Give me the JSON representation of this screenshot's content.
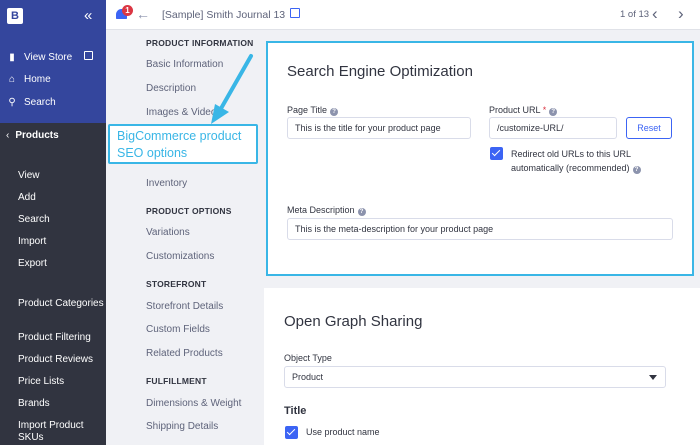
{
  "sidebar": {
    "logo": "B",
    "links": [
      {
        "label": "View Store",
        "icon": "store-icon"
      },
      {
        "label": "Home",
        "icon": "home-icon"
      },
      {
        "label": "Search",
        "icon": "search-icon"
      }
    ],
    "section": "Products",
    "items_group1": [
      "View",
      "Add",
      "Search",
      "Import",
      "Export"
    ],
    "items_group2": [
      "Product Categories",
      "Product Filtering",
      "Product Reviews",
      "Price Lists",
      "Brands",
      "Import Product SKUs"
    ]
  },
  "topbar": {
    "notification_count": "1",
    "title": "[Sample] Smith Journal 13",
    "pager": "1 of 13"
  },
  "subnav": {
    "product_information_heading": "PRODUCT INFORMATION",
    "basic_information": "Basic Information",
    "description": "Description",
    "images_video": "Images & Video",
    "inventory": "Inventory",
    "product_options_heading": "PRODUCT OPTIONS",
    "variations": "Variations",
    "customizations": "Customizations",
    "storefront_heading": "STOREFRONT",
    "storefront_details": "Storefront Details",
    "custom_fields": "Custom Fields",
    "related_products": "Related Products",
    "fulfillment_heading": "FULFILLMENT",
    "dimensions_weight": "Dimensions & Weight",
    "shipping_details": "Shipping Details"
  },
  "annotation": {
    "line1": "BigCommerce product",
    "line2": "SEO options",
    "color": "#39b6e6"
  },
  "seo": {
    "title": "Search Engine Optimization",
    "page_title_label": "Page Title",
    "page_title_value": "This is the title for your product page",
    "product_url_label": "Product URL",
    "required_mark": "*",
    "product_url_value": "/customize-URL/",
    "reset_label": "Reset",
    "redirect_label_line1": "Redirect old URLs to this URL",
    "redirect_label_line2": "automatically (recommended)",
    "meta_description_label": "Meta Description",
    "meta_description_value": "This is the meta-description for your product page"
  },
  "og": {
    "title": "Open Graph Sharing",
    "object_type_label": "Object Type",
    "object_type_value": "Product",
    "title_section": "Title",
    "use_product_name": "Use product name"
  },
  "colors": {
    "sidebar_top": "#34469d",
    "sidebar": "#313440",
    "accent": "#3c64f4",
    "badge": "#db3643"
  }
}
